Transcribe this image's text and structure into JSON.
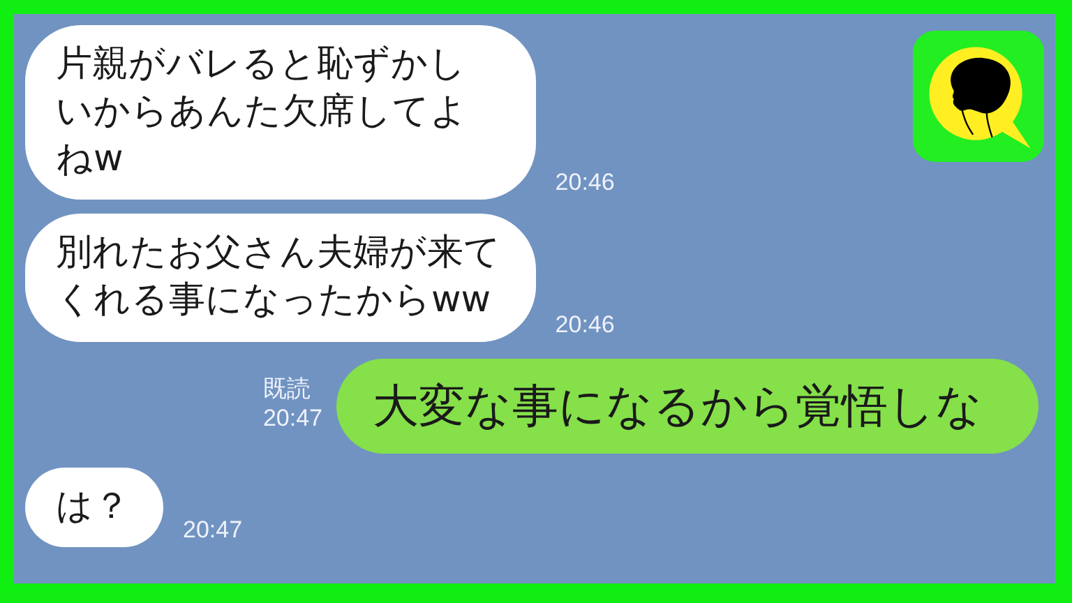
{
  "chat": {
    "messages": [
      {
        "kind": "received",
        "text": "片親がバレると恥ずかしいからあんた欠席してよねw",
        "time": "20:46"
      },
      {
        "kind": "received",
        "text": "別れたお父さん夫婦が来てくれる事になったからww",
        "time": "20:46"
      },
      {
        "kind": "sent",
        "text": "大変な事になるから覚悟しな",
        "read_label": "既読",
        "time": "20:47"
      },
      {
        "kind": "received",
        "text": "は？",
        "time": "20:47"
      }
    ]
  }
}
